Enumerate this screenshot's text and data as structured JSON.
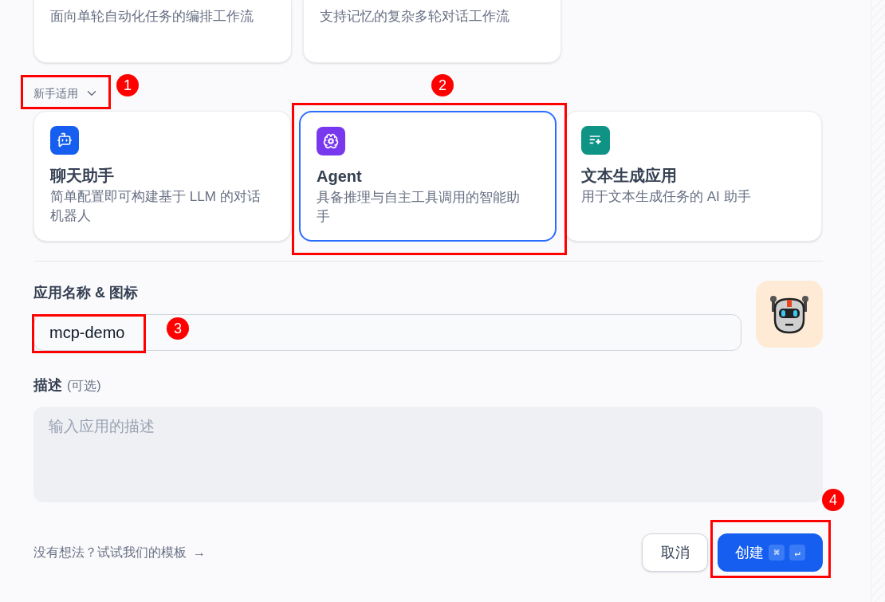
{
  "top_cards": [
    {
      "description": "面向单轮自动化任务的编排工作流"
    },
    {
      "description": "支持记忆的复杂多轮对话工作流"
    }
  ],
  "section_toggle": {
    "label": "新手适用",
    "expanded": true
  },
  "app_types": [
    {
      "kind": "chat",
      "title": "聊天助手",
      "description": "简单配置即可构建基于 LLM 的对话机器人",
      "selected": false
    },
    {
      "kind": "agent",
      "title": "Agent",
      "description": "具备推理与自主工具调用的智能助手",
      "selected": true
    },
    {
      "kind": "text",
      "title": "文本生成应用",
      "description": "用于文本生成任务的 AI 助手",
      "selected": false
    }
  ],
  "name_field": {
    "label": "应用名称 & 图标",
    "value": "mcp-demo"
  },
  "description_field": {
    "label": "描述",
    "optional": "(可选)",
    "placeholder": "输入应用的描述"
  },
  "template_link": {
    "text": "没有想法？试试我们的模板",
    "arrow": "→"
  },
  "buttons": {
    "cancel": "取消",
    "create": "创建",
    "shortcut_keys": [
      "⌘",
      "↵"
    ]
  },
  "annotations": [
    {
      "label": "1"
    },
    {
      "label": "2"
    },
    {
      "label": "3"
    },
    {
      "label": "4"
    }
  ]
}
